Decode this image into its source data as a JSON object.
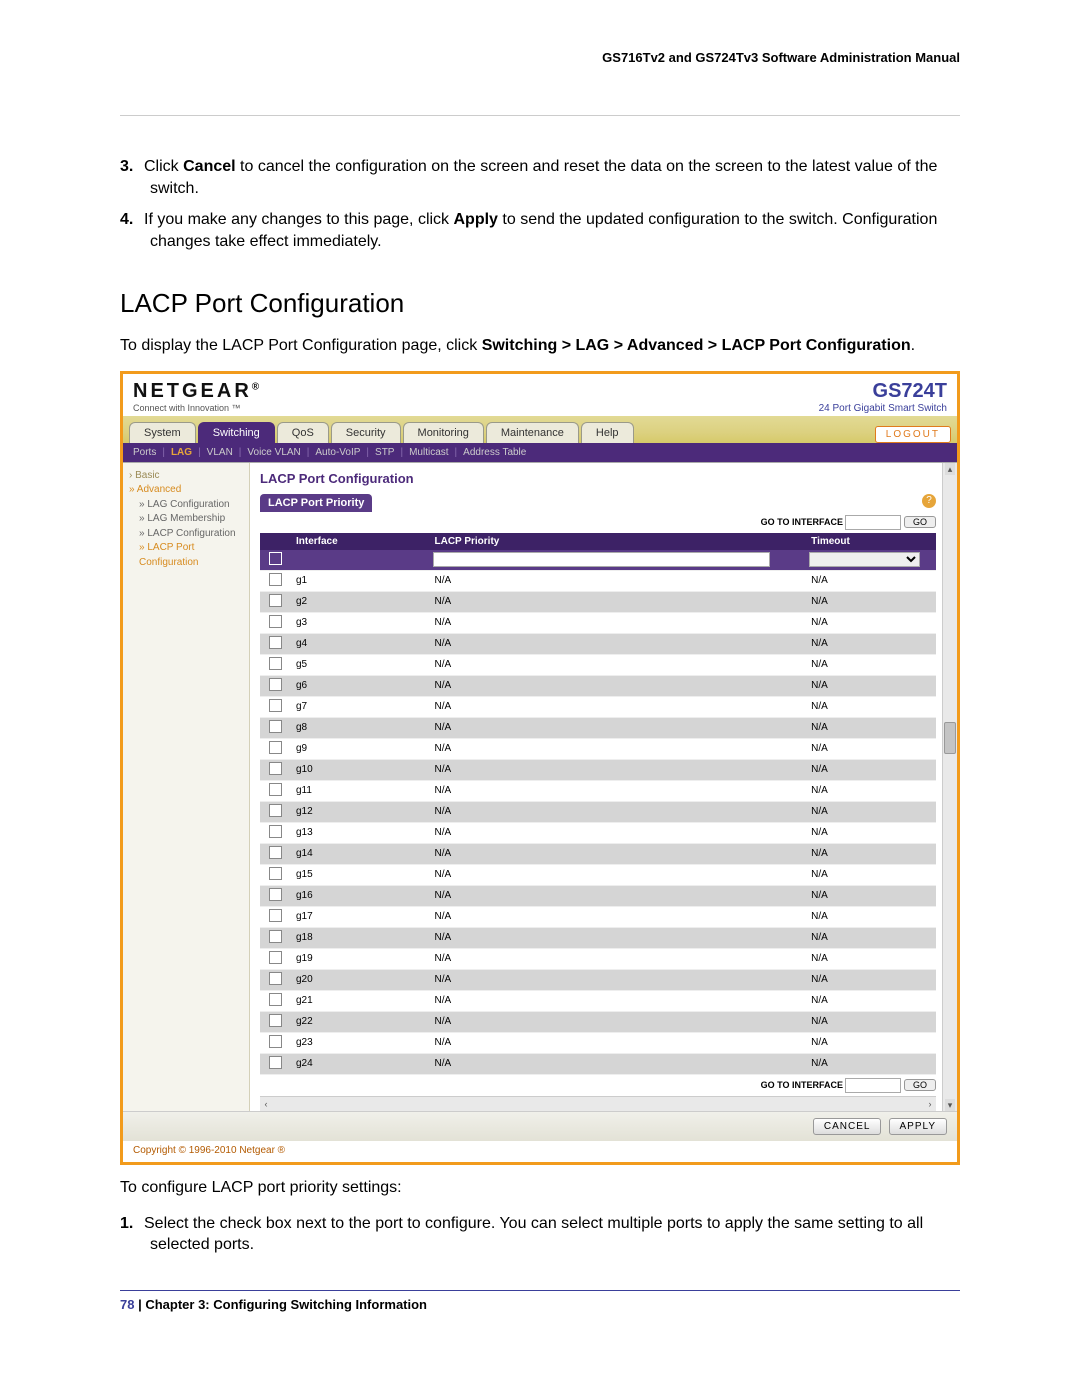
{
  "doc": {
    "header": "GS716Tv2 and GS724Tv3 Software Administration Manual",
    "steps_top": [
      {
        "num": "3.",
        "pre": "Click ",
        "bold": "Cancel",
        "post": " to cancel the configuration on the screen and reset the data on the screen to the latest value of the switch."
      },
      {
        "num": "4.",
        "pre": "If you make any changes to this page, click ",
        "bold": "Apply",
        "post": " to send the updated configuration to the switch. Configuration changes take effect immediately."
      }
    ],
    "section_title": "LACP Port Configuration",
    "intro_pre": "To display the LACP Port Configuration page, click ",
    "intro_path": "Switching > LAG > Advanced > LACP Port Configuration",
    "intro_post": ".",
    "after_shot": "To configure LACP port priority settings:",
    "step_after": {
      "num": "1.",
      "text": "Select the check box next to the port to configure. You can select multiple ports to apply the same setting to all selected ports."
    },
    "footer_page": "78",
    "footer_sep": "   |   ",
    "footer_chapter": "Chapter 3:  Configuring Switching Information"
  },
  "ui": {
    "brand": "NETGEAR",
    "brand_sub": "Connect with Innovation ™",
    "model": "GS724T",
    "model_sub": "24 Port Gigabit Smart Switch",
    "logout": "LOGOUT",
    "tabs": [
      "System",
      "Switching",
      "QoS",
      "Security",
      "Monitoring",
      "Maintenance",
      "Help"
    ],
    "active_tab": "Switching",
    "subnav": [
      "Ports",
      "LAG",
      "VLAN",
      "Voice VLAN",
      "Auto-VoIP",
      "STP",
      "Multicast",
      "Address Table"
    ],
    "subnav_active": "LAG",
    "sidenav": [
      {
        "cls": "lvl0",
        "label": "› Basic"
      },
      {
        "cls": "lvl0 sel",
        "label": "» Advanced"
      },
      {
        "cls": "lvl1",
        "label": "» LAG Configuration"
      },
      {
        "cls": "lvl1",
        "label": "» LAG Membership"
      },
      {
        "cls": "lvl1",
        "label": "» LACP Configuration"
      },
      {
        "cls": "lvl1 sel",
        "label": "» LACP Port Configuration"
      }
    ],
    "panel_title": "LACP Port Configuration",
    "panel_sub": "LACP Port Priority",
    "goto_label": "GO TO INTERFACE",
    "go_btn": "GO",
    "cols": [
      "",
      "Interface",
      "LACP Priority",
      "Timeout"
    ],
    "rows": [
      {
        "if": "g1",
        "p": "N/A",
        "t": "N/A"
      },
      {
        "if": "g2",
        "p": "N/A",
        "t": "N/A"
      },
      {
        "if": "g3",
        "p": "N/A",
        "t": "N/A"
      },
      {
        "if": "g4",
        "p": "N/A",
        "t": "N/A"
      },
      {
        "if": "g5",
        "p": "N/A",
        "t": "N/A"
      },
      {
        "if": "g6",
        "p": "N/A",
        "t": "N/A"
      },
      {
        "if": "g7",
        "p": "N/A",
        "t": "N/A"
      },
      {
        "if": "g8",
        "p": "N/A",
        "t": "N/A"
      },
      {
        "if": "g9",
        "p": "N/A",
        "t": "N/A"
      },
      {
        "if": "g10",
        "p": "N/A",
        "t": "N/A"
      },
      {
        "if": "g11",
        "p": "N/A",
        "t": "N/A"
      },
      {
        "if": "g12",
        "p": "N/A",
        "t": "N/A"
      },
      {
        "if": "g13",
        "p": "N/A",
        "t": "N/A"
      },
      {
        "if": "g14",
        "p": "N/A",
        "t": "N/A"
      },
      {
        "if": "g15",
        "p": "N/A",
        "t": "N/A"
      },
      {
        "if": "g16",
        "p": "N/A",
        "t": "N/A"
      },
      {
        "if": "g17",
        "p": "N/A",
        "t": "N/A"
      },
      {
        "if": "g18",
        "p": "N/A",
        "t": "N/A"
      },
      {
        "if": "g19",
        "p": "N/A",
        "t": "N/A"
      },
      {
        "if": "g20",
        "p": "N/A",
        "t": "N/A"
      },
      {
        "if": "g21",
        "p": "N/A",
        "t": "N/A"
      },
      {
        "if": "g22",
        "p": "N/A",
        "t": "N/A"
      },
      {
        "if": "g23",
        "p": "N/A",
        "t": "N/A"
      },
      {
        "if": "g24",
        "p": "N/A",
        "t": "N/A"
      }
    ],
    "cancel_btn": "CANCEL",
    "apply_btn": "APPLY",
    "copyright": "Copyright © 1996-2010 Netgear ®"
  }
}
